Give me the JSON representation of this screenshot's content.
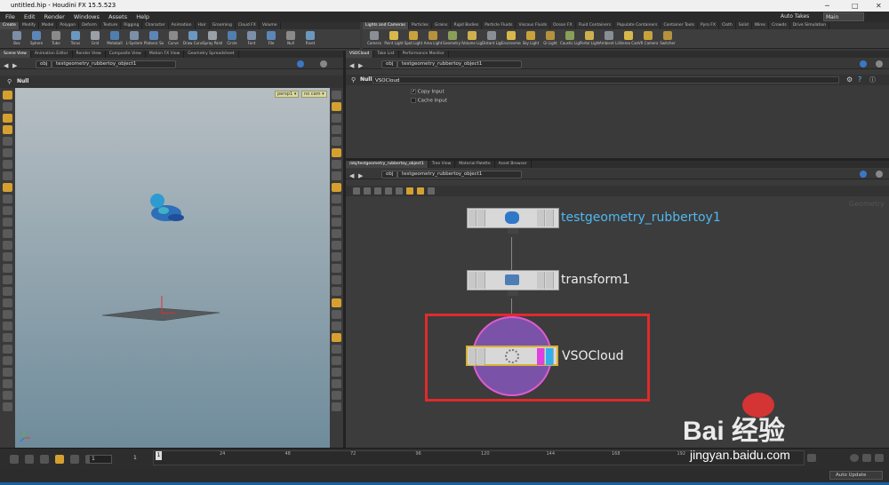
{
  "window": {
    "title": "untitled.hip - Houdini FX 15.5.523",
    "min": "─",
    "max": "□",
    "close": "✕"
  },
  "menu": [
    "File",
    "Edit",
    "Render",
    "Windows",
    "Assets",
    "Help"
  ],
  "right_top": {
    "auto_takes": "Auto Takes",
    "desktop": "Main"
  },
  "shelf_left": {
    "tabs": [
      "Create",
      "Modify",
      "Model",
      "Polygon",
      "Deform",
      "Texture",
      "Rigging",
      "Character",
      "Animation",
      "Hair",
      "Grooming",
      "Cloud FX",
      "Volume"
    ],
    "tools": [
      "Box",
      "Sphere",
      "Tube",
      "Torus",
      "Grid",
      "Metaball",
      "L-System",
      "Platonic Sol...",
      "Curve",
      "Draw Curve",
      "Spray Paint",
      "Circle",
      "Font",
      "File",
      "Null",
      "Rivet"
    ]
  },
  "shelf_right": {
    "tabs": [
      "Lights and Cameras",
      "Particles",
      "Grains",
      "Rigid Bodies",
      "Particle Fluids",
      "Viscous Fluids",
      "Ocean FX",
      "Fluid Containers",
      "Populate Containers",
      "Container Tools",
      "Pyro FX",
      "Cloth",
      "Solid",
      "Wires",
      "Crowds",
      "Drive Simulation"
    ],
    "tools": [
      "Camera",
      "Point Light",
      "Spot Light",
      "Area Light",
      "Geometry L...",
      "Volume Light",
      "Distant Light",
      "Environmen...",
      "Sky Light",
      "GI Light",
      "Caustic Light",
      "Portal Light",
      "Ambient Lig...",
      "Stereo Cam...",
      "VR Camera",
      "Switcher"
    ]
  },
  "left_pane": {
    "tabs": [
      "Scene View",
      "Animation Editor",
      "Render View",
      "Composite View",
      "Motion FX View",
      "Geometry Spreadsheet"
    ],
    "path_root": "obj",
    "path_node": "testgeometry_rubbertoy_object1",
    "op_label": "Null",
    "cam_persp": "persp1 ▾",
    "cam_nocam": "no cam ▾"
  },
  "param_pane": {
    "tabs": [
      "VSOCloud",
      "Take List",
      "Performance Monitor"
    ],
    "path_root": "obj",
    "path_node": "testgeometry_rubbertoy_object1",
    "op_type": "Null",
    "op_name": "VSOCloud",
    "params": [
      {
        "label": "Copy Input",
        "checked": true
      },
      {
        "label": "Cache Input",
        "checked": false
      }
    ]
  },
  "net_pane": {
    "tabs": [
      "/obj/testgeometry_rubbertoy_object1",
      "Tree View",
      "Material Palette",
      "Asset Browser"
    ],
    "path_root": "obj",
    "path_node": "testgeometry_rubbertoy_object1",
    "context": "Geometry",
    "nodes": [
      "testgeometry_rubbertoy1",
      "transform1",
      "VSOCloud"
    ]
  },
  "playbar": {
    "frame": "1",
    "start": "1",
    "current": "1",
    "ticks": [
      "24",
      "48",
      "72",
      "96",
      "120",
      "144",
      "168",
      "192"
    ],
    "auto_update": "Auto Update"
  },
  "watermark": {
    "brand": "Bai  经验",
    "url": "jingyan.baidu.com"
  },
  "colors": {
    "accent": "#d6a030",
    "highlight_box": "#e02b2b",
    "node_label_blue": "#4fb8f0"
  }
}
